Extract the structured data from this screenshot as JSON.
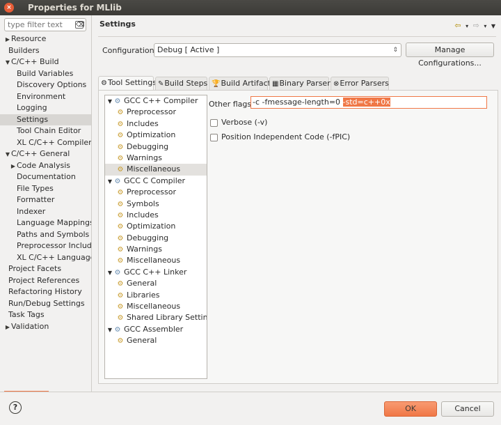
{
  "window": {
    "title": "Properties for MLlib",
    "close_glyph": "×",
    "min_glyph": "−",
    "max_glyph": "□"
  },
  "filter": {
    "placeholder": "type filter text",
    "clear_glyph": "⌫"
  },
  "nav": {
    "items": [
      {
        "label": "Resource",
        "indent": 0,
        "arrow": "▶"
      },
      {
        "label": "Builders",
        "indent": 0,
        "arrow": ""
      },
      {
        "label": "C/C++ Build",
        "indent": 0,
        "arrow": "▼"
      },
      {
        "label": "Build Variables",
        "indent": 1,
        "arrow": ""
      },
      {
        "label": "Discovery Options",
        "indent": 1,
        "arrow": ""
      },
      {
        "label": "Environment",
        "indent": 1,
        "arrow": ""
      },
      {
        "label": "Logging",
        "indent": 1,
        "arrow": ""
      },
      {
        "label": "Settings",
        "indent": 1,
        "arrow": "",
        "selected": true
      },
      {
        "label": "Tool Chain Editor",
        "indent": 1,
        "arrow": ""
      },
      {
        "label": "XL C/C++ Compiler",
        "indent": 1,
        "arrow": ""
      },
      {
        "label": "C/C++ General",
        "indent": 0,
        "arrow": "▼"
      },
      {
        "label": "Code Analysis",
        "indent": 1,
        "arrow": "▶"
      },
      {
        "label": "Documentation",
        "indent": 1,
        "arrow": ""
      },
      {
        "label": "File Types",
        "indent": 1,
        "arrow": ""
      },
      {
        "label": "Formatter",
        "indent": 1,
        "arrow": ""
      },
      {
        "label": "Indexer",
        "indent": 1,
        "arrow": ""
      },
      {
        "label": "Language Mappings",
        "indent": 1,
        "arrow": ""
      },
      {
        "label": "Paths and Symbols",
        "indent": 1,
        "arrow": ""
      },
      {
        "label": "Preprocessor Include",
        "indent": 1,
        "arrow": ""
      },
      {
        "label": "XL C/C++ Language C",
        "indent": 1,
        "arrow": ""
      },
      {
        "label": "Project Facets",
        "indent": 0,
        "arrow": ""
      },
      {
        "label": "Project References",
        "indent": 0,
        "arrow": ""
      },
      {
        "label": "Refactoring History",
        "indent": 0,
        "arrow": ""
      },
      {
        "label": "Run/Debug Settings",
        "indent": 0,
        "arrow": ""
      },
      {
        "label": "Task Tags",
        "indent": 0,
        "arrow": ""
      },
      {
        "label": "Validation",
        "indent": 0,
        "arrow": "▶"
      }
    ]
  },
  "main": {
    "title": "Settings",
    "nav_icons": {
      "back": "⇦",
      "forward": "⇨",
      "dropdown": "▾",
      "menu": "▼"
    },
    "config_label": "Configuration:",
    "config_value": "Debug  [ Active ]",
    "config_chevron": "⇕",
    "manage_label": "Manage Configurations...",
    "tabs": [
      {
        "label": "Tool Settings",
        "icon": "⚙",
        "active": true
      },
      {
        "label": "Build Steps",
        "icon": "✎"
      },
      {
        "label": "Build Artifact",
        "icon": "🏆"
      },
      {
        "label": "Binary Parsers",
        "icon": "▦"
      },
      {
        "label": "Error Parsers",
        "icon": "⊗"
      }
    ],
    "tree": [
      {
        "label": "GCC C++ Compiler",
        "level": 0,
        "arrow": "▼",
        "icon": "⚙"
      },
      {
        "label": "Preprocessor",
        "level": 1,
        "icon": "⚙"
      },
      {
        "label": "Includes",
        "level": 1,
        "icon": "⚙"
      },
      {
        "label": "Optimization",
        "level": 1,
        "icon": "⚙"
      },
      {
        "label": "Debugging",
        "level": 1,
        "icon": "⚙"
      },
      {
        "label": "Warnings",
        "level": 1,
        "icon": "⚙"
      },
      {
        "label": "Miscellaneous",
        "level": 1,
        "icon": "⚙",
        "selected": true
      },
      {
        "label": "GCC C Compiler",
        "level": 0,
        "arrow": "▼",
        "icon": "⚙"
      },
      {
        "label": "Preprocessor",
        "level": 1,
        "icon": "⚙"
      },
      {
        "label": "Symbols",
        "level": 1,
        "icon": "⚙"
      },
      {
        "label": "Includes",
        "level": 1,
        "icon": "⚙"
      },
      {
        "label": "Optimization",
        "level": 1,
        "icon": "⚙"
      },
      {
        "label": "Debugging",
        "level": 1,
        "icon": "⚙"
      },
      {
        "label": "Warnings",
        "level": 1,
        "icon": "⚙"
      },
      {
        "label": "Miscellaneous",
        "level": 1,
        "icon": "⚙"
      },
      {
        "label": "GCC C++ Linker",
        "level": 0,
        "arrow": "▼",
        "icon": "⚙"
      },
      {
        "label": "General",
        "level": 1,
        "icon": "⚙"
      },
      {
        "label": "Libraries",
        "level": 1,
        "icon": "⚙"
      },
      {
        "label": "Miscellaneous",
        "level": 1,
        "icon": "⚙"
      },
      {
        "label": "Shared Library Settings",
        "level": 1,
        "icon": "⚙"
      },
      {
        "label": "GCC Assembler",
        "level": 0,
        "arrow": "▼",
        "icon": "⚙"
      },
      {
        "label": "General",
        "level": 1,
        "icon": "⚙"
      }
    ],
    "form": {
      "other_flags_label": "Other flags",
      "other_flags_value_plain": "-c -fmessage-length=0 ",
      "other_flags_value_selected": "-std=c++0x",
      "verbose_label": "Verbose (-v)",
      "fpic_label": "Position Independent Code (-fPIC)"
    }
  },
  "footer": {
    "help_glyph": "?",
    "ok_label": "OK",
    "cancel_label": "Cancel"
  },
  "colors": {
    "accent": "#f07746",
    "titlebar": "#3c3b37",
    "selection": "#d8d6d3"
  }
}
